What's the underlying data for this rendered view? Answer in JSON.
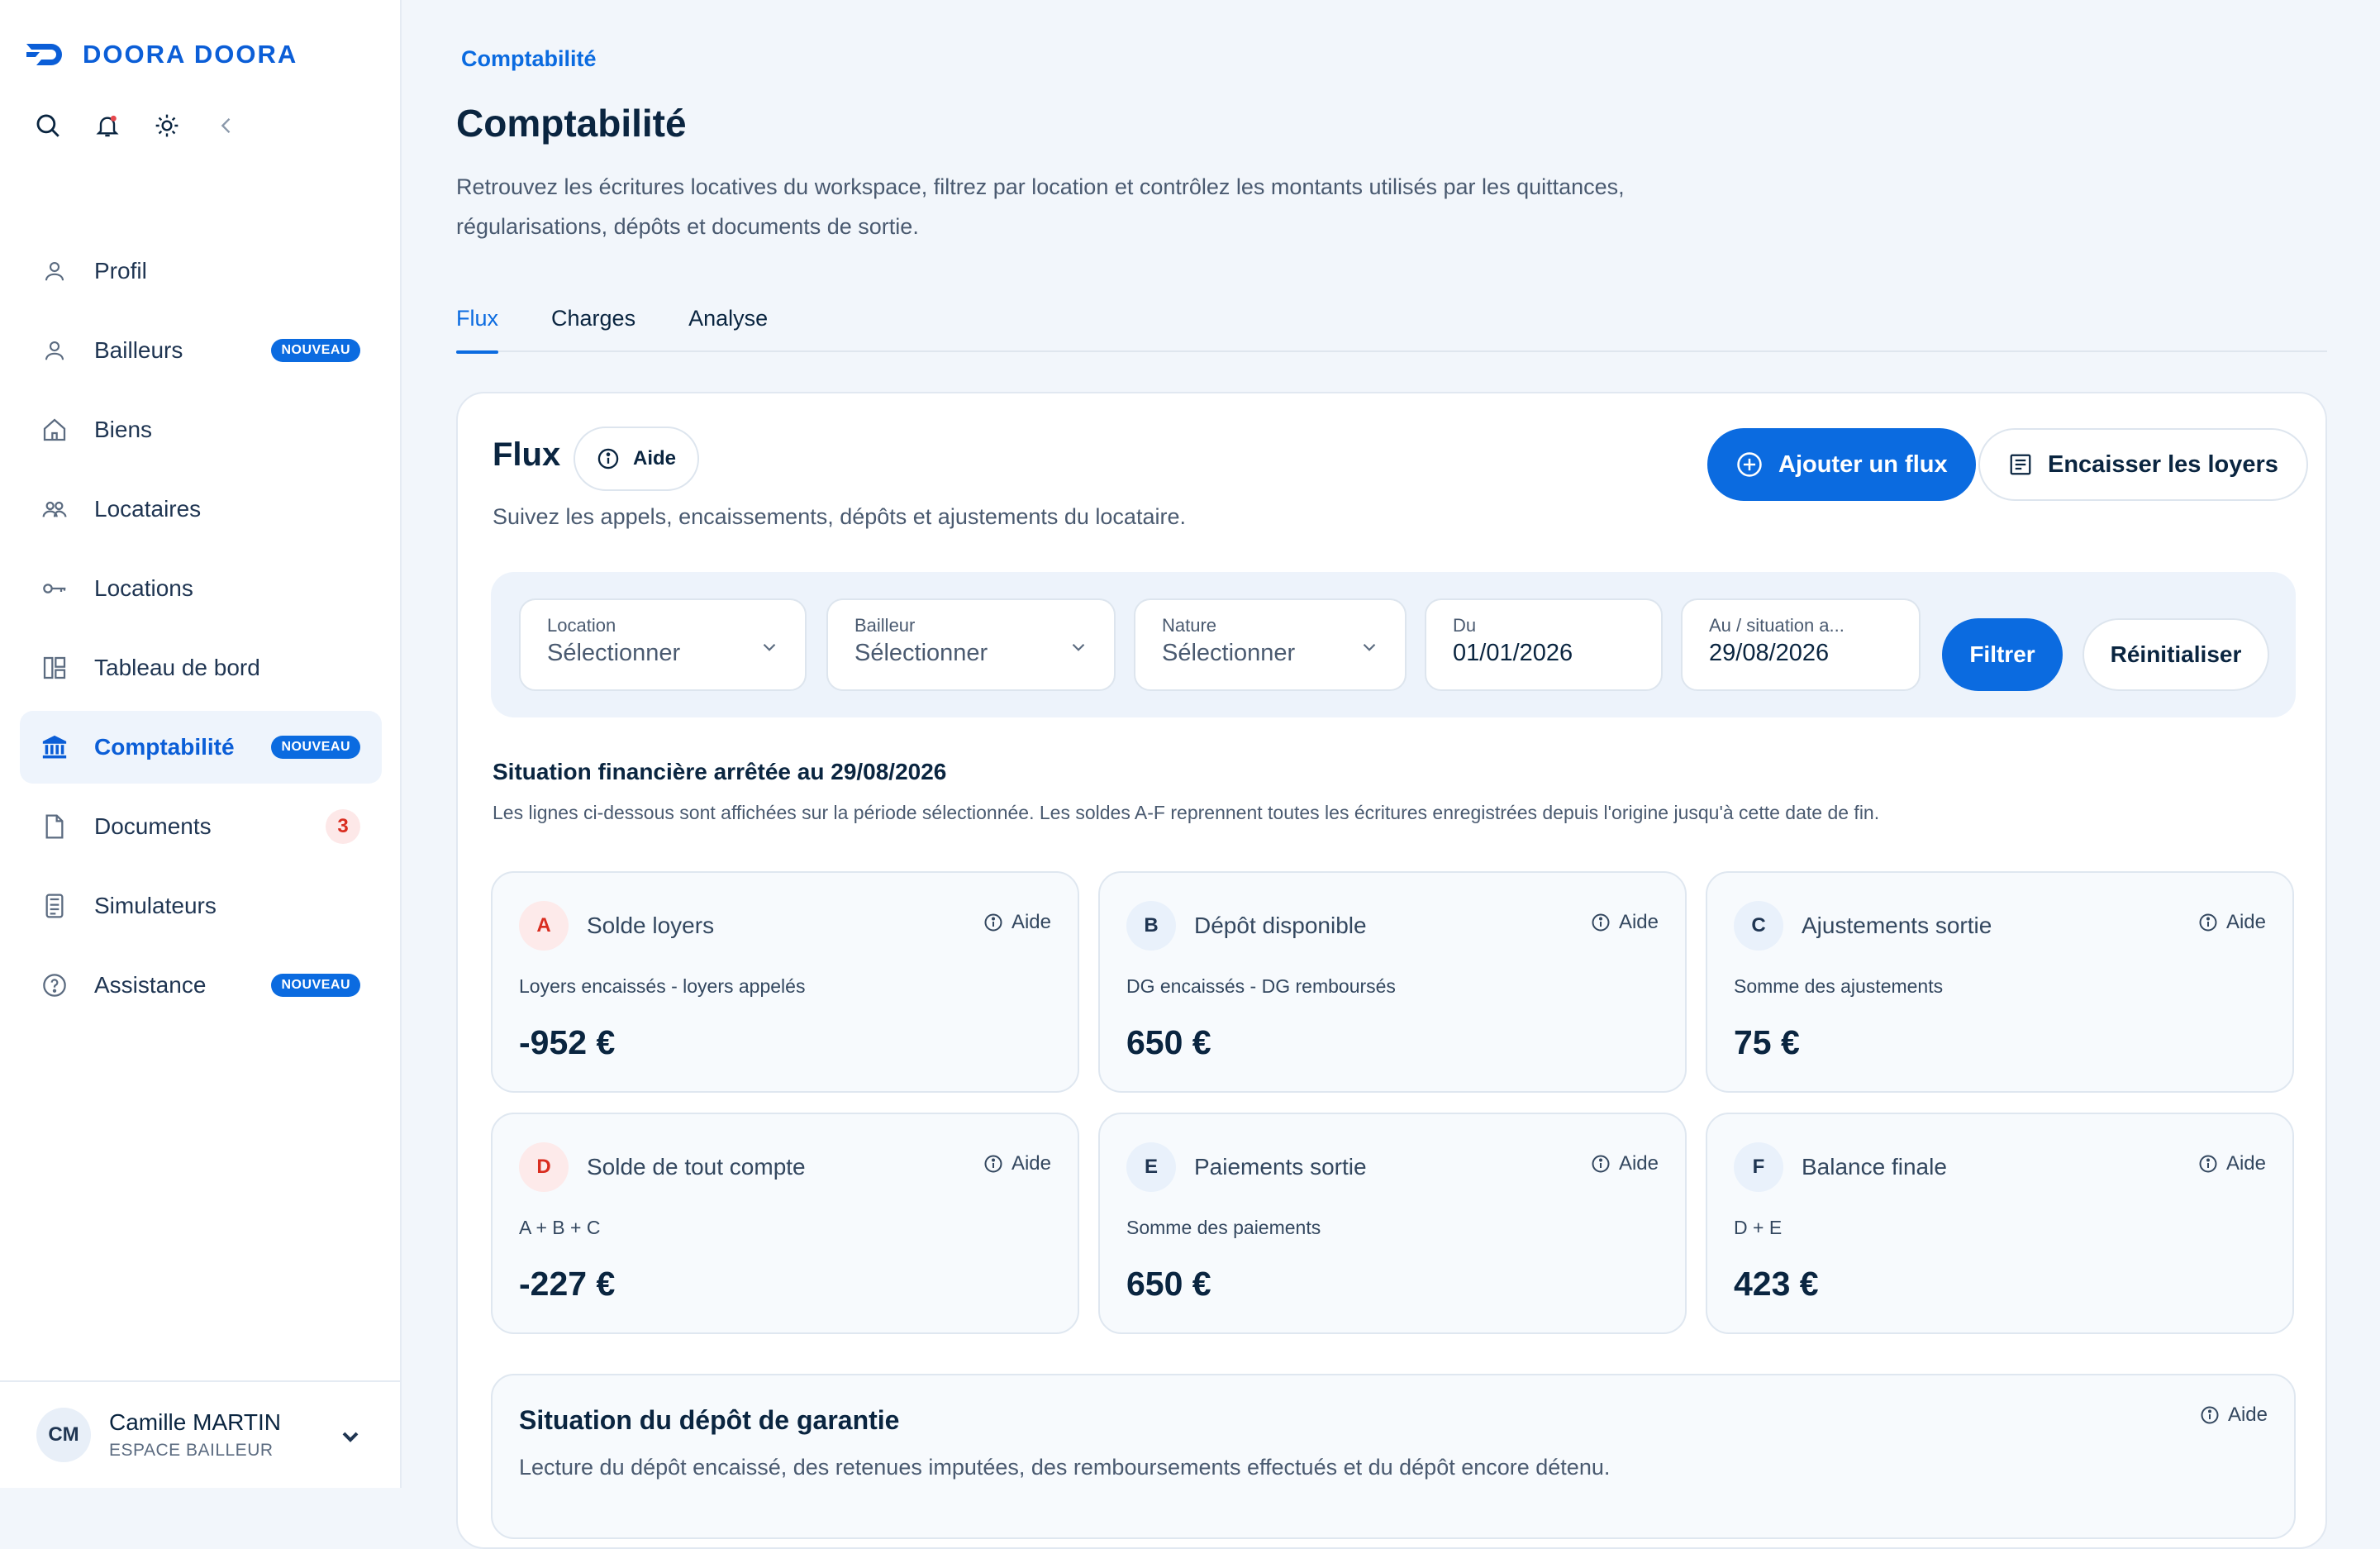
{
  "app": {
    "logo_text": "DOORA DOORA",
    "accent": "#0b6be0"
  },
  "sidebar": {
    "items": [
      {
        "label": "Profil",
        "icon": "user-icon"
      },
      {
        "label": "Bailleurs",
        "icon": "user-icon",
        "badge": "NOUVEAU"
      },
      {
        "label": "Biens",
        "icon": "home-icon"
      },
      {
        "label": "Locataires",
        "icon": "users-icon"
      },
      {
        "label": "Locations",
        "icon": "key-icon"
      },
      {
        "label": "Tableau de bord",
        "icon": "dashboard-icon"
      },
      {
        "label": "Comptabilité",
        "icon": "bank-icon",
        "badge": "NOUVEAU",
        "active": true
      },
      {
        "label": "Documents",
        "icon": "document-icon",
        "count": "3"
      },
      {
        "label": "Simulateurs",
        "icon": "calculator-icon"
      },
      {
        "label": "Assistance",
        "icon": "help-icon",
        "badge": "NOUVEAU"
      }
    ],
    "user": {
      "initials": "CM",
      "name": "Camille MARTIN",
      "role": "ESPACE BAILLEUR"
    }
  },
  "header": {
    "breadcrumb": "Comptabilité",
    "title": "Comptabilité",
    "description": "Retrouvez les écritures locatives du workspace, filtrez par location et contrôlez les montants utilisés par les quittances, régularisations, dépôts et documents de sortie."
  },
  "tabs": [
    {
      "label": "Flux",
      "active": true
    },
    {
      "label": "Charges"
    },
    {
      "label": "Analyse"
    }
  ],
  "flux": {
    "title": "Flux",
    "aide_label": "Aide",
    "subtitle": "Suivez les appels, encaissements, dépôts et ajustements du locataire.",
    "add_button": "Ajouter un flux",
    "collect_button": "Encaisser les loyers"
  },
  "filters": {
    "location": {
      "label": "Location",
      "value": "Sélectionner"
    },
    "bailleur": {
      "label": "Bailleur",
      "value": "Sélectionner"
    },
    "nature": {
      "label": "Nature",
      "value": "Sélectionner"
    },
    "from": {
      "label": "Du",
      "value": "01/01/2026"
    },
    "to": {
      "label": "Au / situation a...",
      "value": "29/08/2026"
    },
    "filter_button": "Filtrer",
    "reset_button": "Réinitialiser"
  },
  "situation": {
    "title": "Situation financière arrêtée au 29/08/2026",
    "subtitle": "Les lignes ci-dessous sont affichées sur la période sélectionnée. Les soldes A-F reprennent toutes les écritures enregistrées depuis l'origine jusqu'à cette date de fin."
  },
  "kpis": [
    {
      "letter": "A",
      "title": "Solde loyers",
      "formula": "Loyers encaissés - loyers appelés",
      "value": "-952 €",
      "tone": "red",
      "aide": "Aide"
    },
    {
      "letter": "B",
      "title": "Dépôt disponible",
      "formula": "DG encaissés - DG remboursés",
      "value": "650 €",
      "tone": "blue",
      "aide": "Aide"
    },
    {
      "letter": "C",
      "title": "Ajustements sortie",
      "formula": "Somme des ajustements",
      "value": "75 €",
      "tone": "blue",
      "aide": "Aide"
    },
    {
      "letter": "D",
      "title": "Solde de tout compte",
      "formula": "A + B + C",
      "value": "-227 €",
      "tone": "red",
      "aide": "Aide"
    },
    {
      "letter": "E",
      "title": "Paiements sortie",
      "formula": "Somme des paiements",
      "value": "650 €",
      "tone": "blue",
      "aide": "Aide"
    },
    {
      "letter": "F",
      "title": "Balance finale",
      "formula": "D + E",
      "value": "423 €",
      "tone": "blue",
      "aide": "Aide"
    }
  ],
  "deposit": {
    "title": "Situation du dépôt de garantie",
    "subtitle": "Lecture du dépôt encaissé, des retenues imputées, des remboursements effectués et du dépôt encore détenu.",
    "aide": "Aide"
  }
}
